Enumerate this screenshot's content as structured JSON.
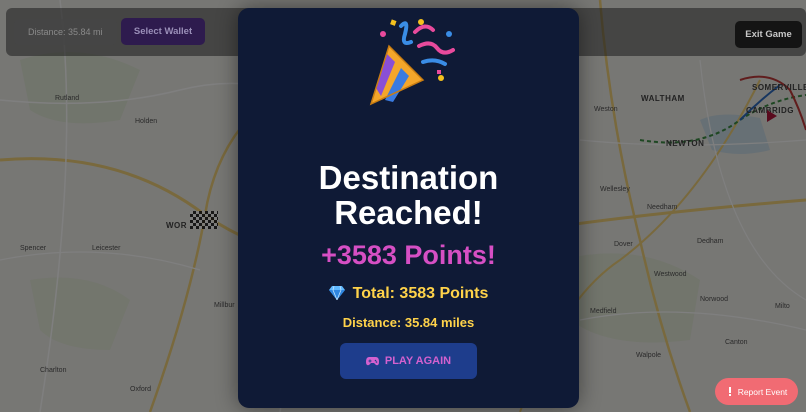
{
  "top_bar": {
    "distance_chip": "Distance: 35.84 mi",
    "select_wallet_label": "Select Wallet",
    "exit_game_label": "Exit Game"
  },
  "map": {
    "labels": {
      "rutland": "Rutland",
      "holden": "Holden",
      "worcester": "WOR",
      "leicester": "Leicester",
      "spencer": "Spencer",
      "millbury": "Millbur",
      "charlton": "Charlton",
      "oxford": "Oxford",
      "weston": "Weston",
      "waltham": "WALTHAM",
      "newton": "NEWTON",
      "wellesley": "Wellesley",
      "needham": "Needham",
      "dover": "Dover",
      "dedham": "Dedham",
      "westwood": "Westwood",
      "norwood": "Norwood",
      "medfield": "Medfield",
      "walpole": "Walpole",
      "canton": "Canton",
      "cambridge": "CAMBRIDG",
      "somerville": "SOMERVILLE",
      "milton": "Milto"
    }
  },
  "modal": {
    "icon": "party-popper-icon",
    "title": "Destination Reached!",
    "points": "+3583 Points!",
    "total_icon": "gem-icon",
    "total": "Total: 3583 Points",
    "distance": "Distance: 35.84 miles",
    "play_again_icon": "gamepad-icon",
    "play_again_label": "PLAY AGAIN"
  },
  "report_button": {
    "icon": "alert-icon",
    "label": "Report Event"
  },
  "colors": {
    "modal_bg": "#0f1a36",
    "title": "#ffffff",
    "points": "#d64fc4",
    "total": "#ffd34a",
    "play_button_bg": "#1e3d8c",
    "play_button_text": "#d461cf",
    "report_button_bg": "#f16b73",
    "wallet_button_bg": "#2e1b4e"
  }
}
